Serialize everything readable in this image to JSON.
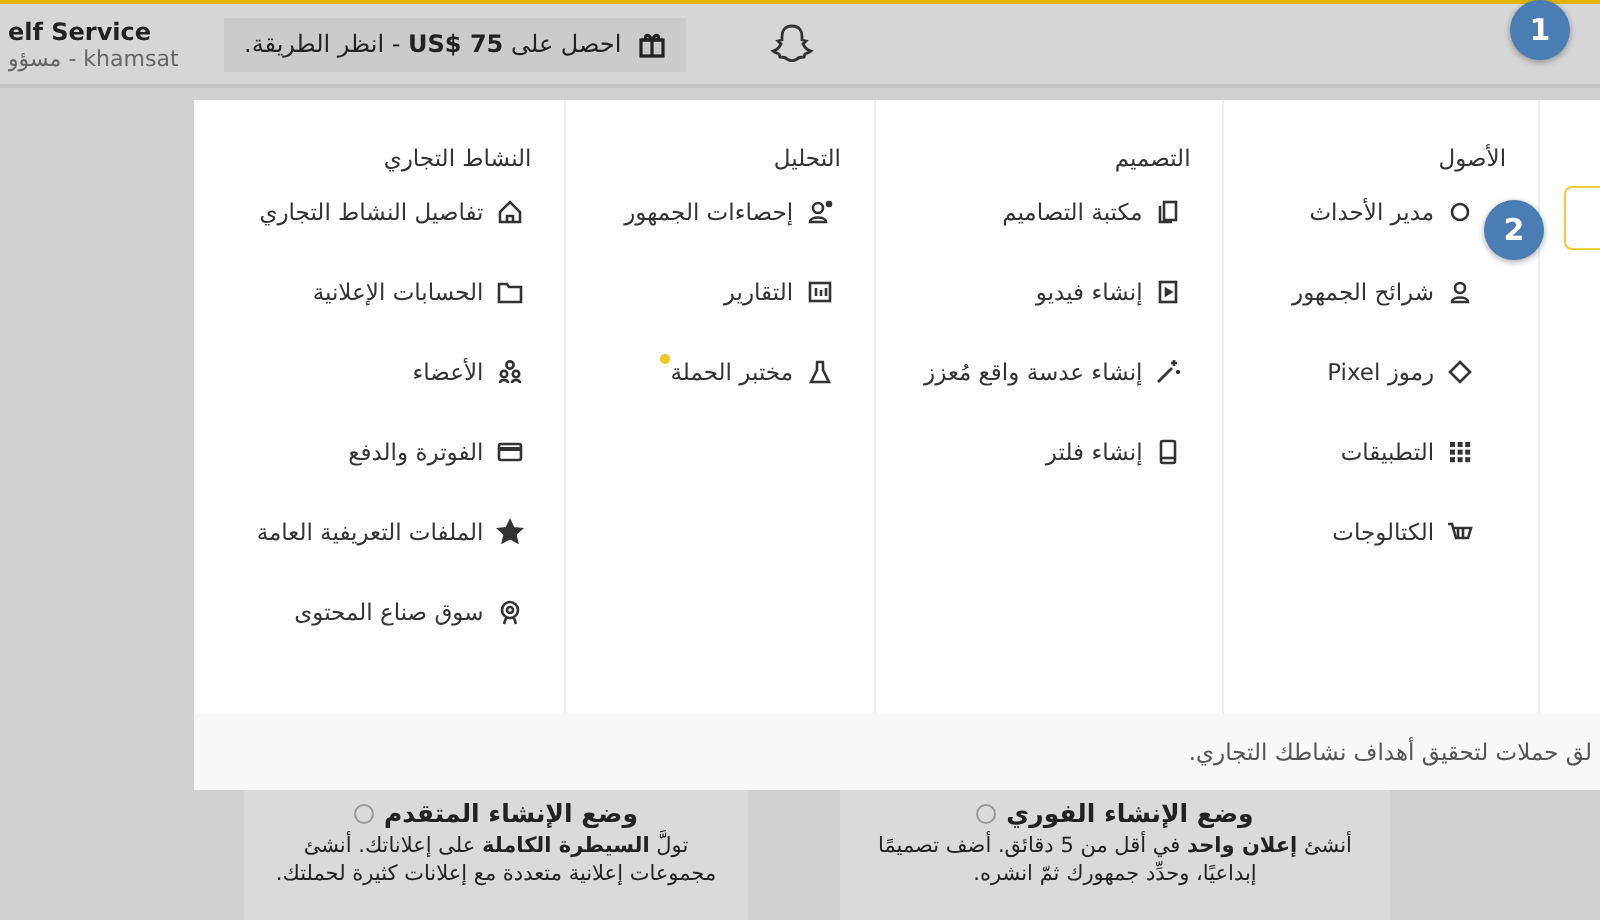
{
  "top_bar": {
    "account_title": "elf Service",
    "account_subtitle": "khamsat - مسؤو",
    "promo": "احصل على **US$ 75** - انظر الطريقة."
  },
  "step_markers": [
    "1",
    "2"
  ],
  "menu": {
    "columns": [
      {
        "heading": "الأصول",
        "items": [
          {
            "label": "مدير الأحداث",
            "new": false
          },
          {
            "label": "شرائح الجمهور",
            "new": false
          },
          {
            "label": "رموز Pixel",
            "new": false
          },
          {
            "label": "التطبيقات",
            "new": false
          },
          {
            "label": "الكتالوجات",
            "new": false
          }
        ]
      },
      {
        "heading": "التصميم",
        "items": [
          {
            "label": "مكتبة التصاميم",
            "new": false
          },
          {
            "label": "إنشاء فيديو",
            "new": false
          },
          {
            "label": "إنشاء عدسة واقع مُعزز",
            "new": false
          },
          {
            "label": "إنشاء فلتر",
            "new": false
          }
        ]
      },
      {
        "heading": "التحليل",
        "items": [
          {
            "label": "إحصاءات الجمهور",
            "new": false
          },
          {
            "label": "التقارير",
            "new": false
          },
          {
            "label": "مختبر الحملة",
            "new": true
          }
        ]
      },
      {
        "heading": "النشاط التجاري",
        "items": [
          {
            "label": "تفاصيل النشاط التجاري",
            "new": false
          },
          {
            "label": "الحسابات الإعلانية",
            "new": false
          },
          {
            "label": "الأعضاء",
            "new": false
          },
          {
            "label": "الفوترة والدفع",
            "new": false
          },
          {
            "label": "الملفات التعريفية العامة",
            "new": false
          },
          {
            "label": "سوق صناع المحتوى",
            "new": false
          }
        ]
      }
    ],
    "footer": "لق حملات لتحقيق أهداف نشاطك التجاري."
  },
  "modes": [
    {
      "title": "وضع الإنشاء الفوري",
      "description": "أنشئ **إعلان واحد** في أقل من 5 دقائق. أضف تصميمًا إبداعيًا، وحدِّد جمهورك ثمّ انشره."
    },
    {
      "title": "وضع الإنشاء المتقدم",
      "description": "تولَّ **السيطرة الكاملة** على إعلاناتك. أنشئ مجموعات إعلانية متعددة مع إعلانات كثيرة لحملتك."
    }
  ]
}
